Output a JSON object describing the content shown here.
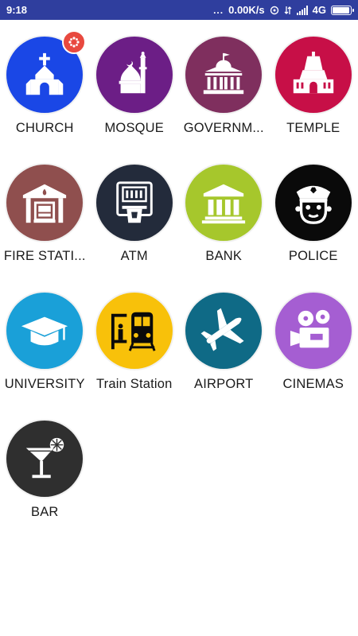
{
  "status_bar": {
    "time": "9:18",
    "dots": "...",
    "network_speed": "0.00K/s",
    "network_type": "4G",
    "background_color": "#2f3e9e",
    "battery_level": 0.95
  },
  "places": [
    {
      "label": "CHURCH",
      "color": "#1a47e6",
      "icon": "church-icon"
    },
    {
      "label": "MOSQUE",
      "color": "#6c1e86",
      "icon": "mosque-icon"
    },
    {
      "label": "GOVERNM...",
      "color": "#7f2f5e",
      "icon": "government-building-icon"
    },
    {
      "label": "TEMPLE",
      "color": "#c70f47",
      "icon": "temple-icon"
    },
    {
      "label": "FIRE STATI...",
      "color": "#8f4f4e",
      "icon": "fire-station-icon"
    },
    {
      "label": "ATM",
      "color": "#232b3b",
      "icon": "atm-icon"
    },
    {
      "label": "BANK",
      "color": "#a6c72c",
      "icon": "bank-icon"
    },
    {
      "label": "POLICE",
      "color": "#0a0a0a",
      "icon": "police-icon"
    },
    {
      "label": "UNIVERSITY",
      "color": "#1aa0d8",
      "icon": "graduation-cap-icon"
    },
    {
      "label": "Train Station",
      "color": "#f8c10a",
      "icon": "train-icon"
    },
    {
      "label": "AIRPORT",
      "color": "#0f6a86",
      "icon": "airplane-icon"
    },
    {
      "label": "CINEMAS",
      "color": "#a55ed2",
      "icon": "movie-camera-icon"
    },
    {
      "label": "BAR",
      "color": "#2f2f2f",
      "icon": "cocktail-icon"
    }
  ],
  "badge": {
    "color": "#e8493f",
    "icon": "settings-flower-icon"
  }
}
